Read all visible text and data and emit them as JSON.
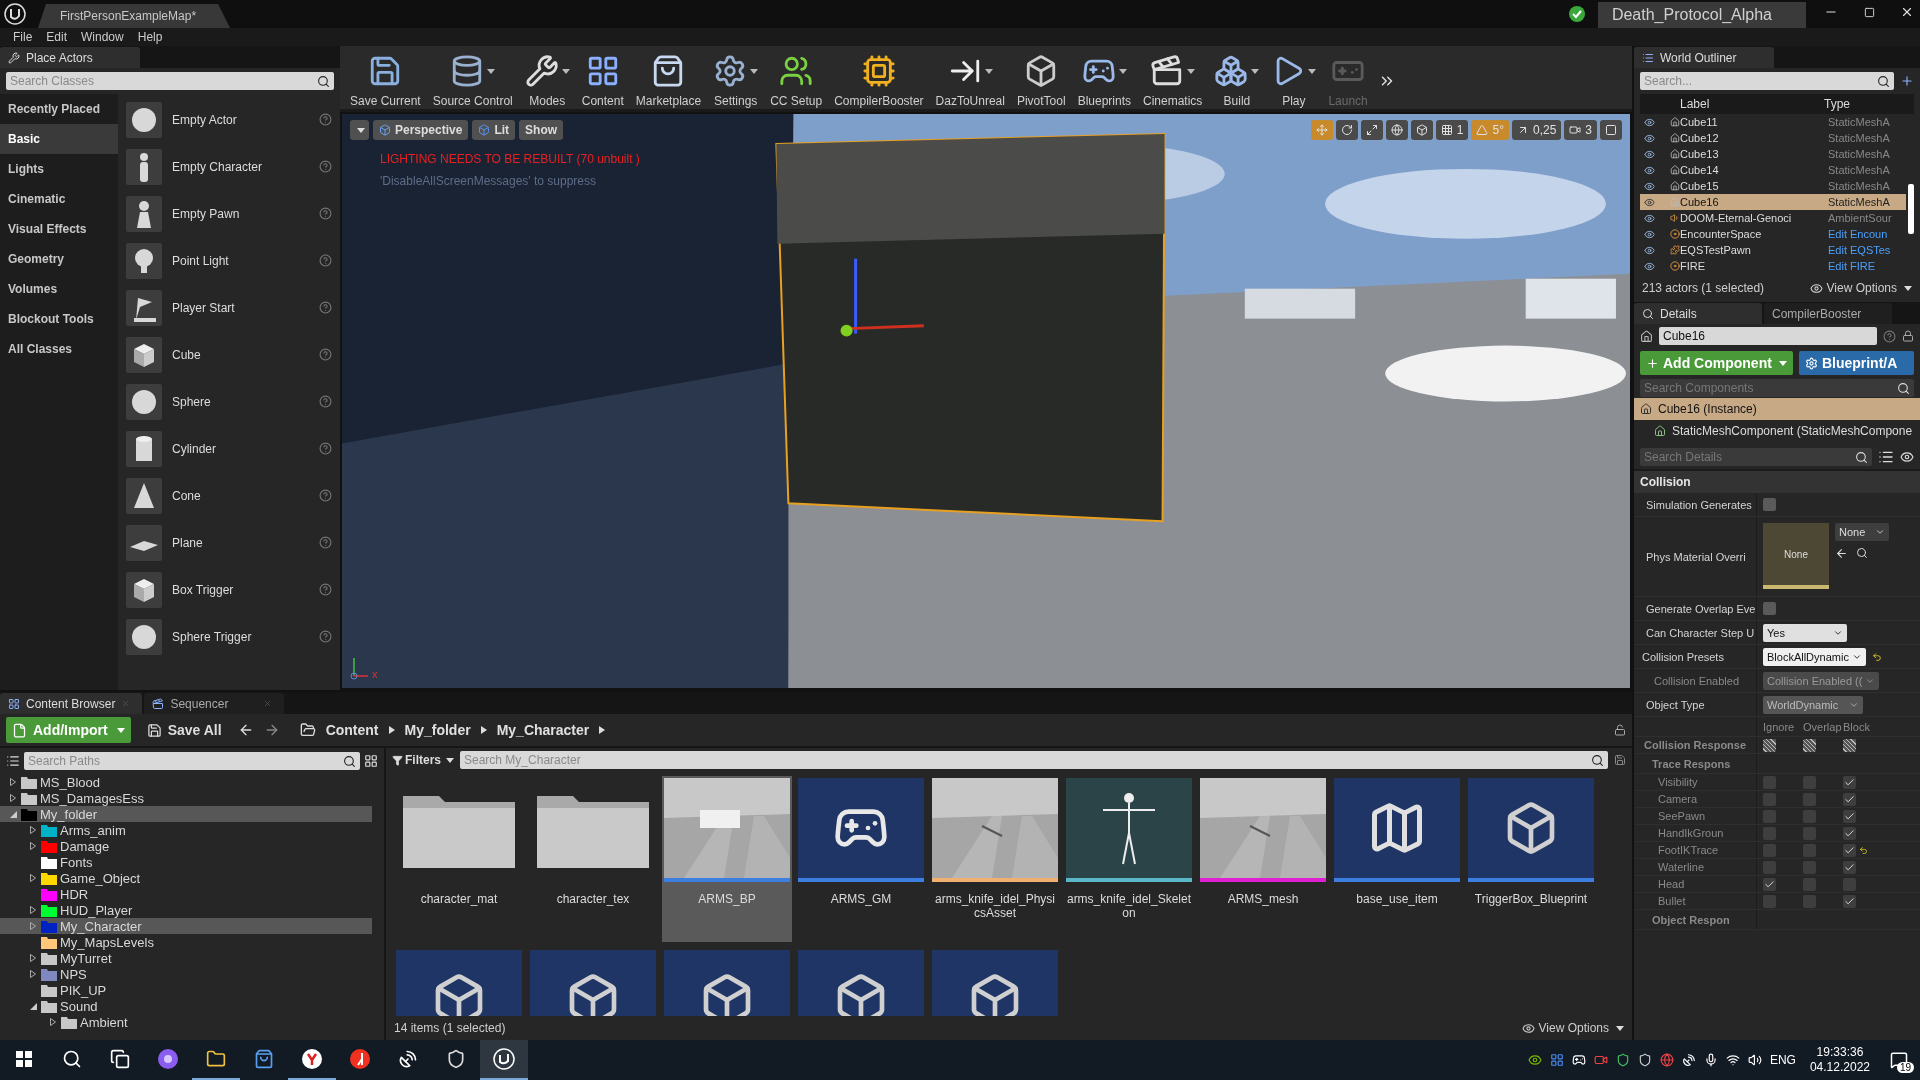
{
  "title_bar": {
    "tab": "FirstPersonExampleMap*",
    "project": "Death_Protocol_Alpha"
  },
  "menu": [
    "File",
    "Edit",
    "Window",
    "Help"
  ],
  "place_actors": {
    "tab": "Place Actors",
    "search_placeholder": "Search Classes",
    "categories": [
      {
        "label": "Recently Placed",
        "selected": false
      },
      {
        "label": "Basic",
        "selected": true
      },
      {
        "label": "Lights",
        "selected": false
      },
      {
        "label": "Cinematic",
        "selected": false
      },
      {
        "label": "Visual Effects",
        "selected": false
      },
      {
        "label": "Geometry",
        "selected": false
      },
      {
        "label": "Volumes",
        "selected": false
      },
      {
        "label": "Blockout Tools",
        "selected": false
      },
      {
        "label": "All Classes",
        "selected": false
      }
    ],
    "actors": [
      {
        "label": "Empty Actor",
        "kind": "sphere"
      },
      {
        "label": "Empty Character",
        "kind": "person"
      },
      {
        "label": "Empty Pawn",
        "kind": "pawn"
      },
      {
        "label": "Point Light",
        "kind": "light"
      },
      {
        "label": "Player Start",
        "kind": "flag"
      },
      {
        "label": "Cube",
        "kind": "cube"
      },
      {
        "label": "Sphere",
        "kind": "sphere"
      },
      {
        "label": "Cylinder",
        "kind": "cylinder"
      },
      {
        "label": "Cone",
        "kind": "cone"
      },
      {
        "label": "Plane",
        "kind": "plane"
      },
      {
        "label": "Box Trigger",
        "kind": "cube"
      },
      {
        "label": "Sphere Trigger",
        "kind": "sphere"
      }
    ]
  },
  "toolbar": [
    {
      "label": "Save Current",
      "kind": "save",
      "dropdown": false,
      "disabled": false
    },
    {
      "label": "Source Control",
      "kind": "source",
      "dropdown": true,
      "disabled": false
    },
    {
      "label": "Modes",
      "kind": "modes",
      "dropdown": true,
      "disabled": false
    },
    {
      "label": "Content",
      "kind": "content",
      "dropdown": false,
      "disabled": false
    },
    {
      "label": "Marketplace",
      "kind": "marketplace",
      "dropdown": false,
      "disabled": false
    },
    {
      "label": "Settings",
      "kind": "settings",
      "dropdown": true,
      "disabled": false
    },
    {
      "label": "CC Setup",
      "kind": "cc",
      "dropdown": false,
      "disabled": false
    },
    {
      "label": "CompilerBooster",
      "kind": "compiler",
      "dropdown": false,
      "disabled": false
    },
    {
      "label": "DazToUnreal",
      "kind": "daz",
      "dropdown": true,
      "disabled": false
    },
    {
      "label": "PivotTool",
      "kind": "pivot",
      "dropdown": false,
      "disabled": false
    },
    {
      "label": "Blueprints",
      "kind": "blueprints",
      "dropdown": true,
      "disabled": false
    },
    {
      "label": "Cinematics",
      "kind": "cinematics",
      "dropdown": true,
      "disabled": false
    },
    {
      "label": "Build",
      "kind": "build",
      "dropdown": true,
      "disabled": false
    },
    {
      "label": "Play",
      "kind": "play",
      "dropdown": true,
      "disabled": false
    },
    {
      "label": "Launch",
      "kind": "launch",
      "dropdown": false,
      "disabled": true
    }
  ],
  "viewport": {
    "menu_buttons": [
      {
        "label": "Perspective",
        "kind": "perspective"
      },
      {
        "label": "Lit",
        "kind": "lit"
      },
      {
        "label": "Show",
        "kind": "plain"
      }
    ],
    "warning": "LIGHTING NEEDS TO BE REBUILT (70 unbuilt )",
    "hint": "'DisableAllScreenMessages' to suppress",
    "axis_label": "x",
    "tools": [
      {
        "kind": "translate",
        "selected": true
      },
      {
        "kind": "rotate",
        "selected": false
      },
      {
        "kind": "scale",
        "selected": false
      },
      {
        "kind": "world",
        "selected": false
      },
      {
        "kind": "surface",
        "selected": false
      },
      {
        "kind": "grid",
        "selected": false,
        "value": "1"
      },
      {
        "kind": "angle",
        "selected": true,
        "value": "5°"
      },
      {
        "kind": "scale_snap",
        "selected": false,
        "value": "0,25"
      },
      {
        "kind": "camera_speed",
        "selected": false,
        "value": "3"
      },
      {
        "kind": "maximize",
        "selected": false
      }
    ]
  },
  "world_outliner": {
    "tab": "World Outliner",
    "search_placeholder": "Search...",
    "columns": [
      "Label",
      "Type"
    ],
    "rows": [
      {
        "label": "Cube11",
        "type": "StaticMeshA",
        "type_link": false,
        "kind": "mesh",
        "selected": false
      },
      {
        "label": "Cube12",
        "type": "StaticMeshA",
        "type_link": false,
        "kind": "mesh",
        "selected": false
      },
      {
        "label": "Cube13",
        "type": "StaticMeshA",
        "type_link": false,
        "kind": "mesh",
        "selected": false
      },
      {
        "label": "Cube14",
        "type": "StaticMeshA",
        "type_link": false,
        "kind": "mesh",
        "selected": false
      },
      {
        "label": "Cube15",
        "type": "StaticMeshA",
        "type_link": false,
        "kind": "mesh",
        "selected": false
      },
      {
        "label": "Cube16",
        "type": "StaticMeshA",
        "type_link": false,
        "kind": "mesh",
        "selected": true
      },
      {
        "label": "DOOM-Eternal-Genoci",
        "type": "AmbientSour",
        "type_link": false,
        "kind": "sound",
        "selected": false
      },
      {
        "label": "EncounterSpace",
        "type": "Edit Encoun",
        "type_link": true,
        "kind": "blueprint",
        "selected": false
      },
      {
        "label": "EQSTestPawn",
        "type": "Edit EQSTes",
        "type_link": true,
        "kind": "pawn",
        "selected": false
      },
      {
        "label": "FIRE",
        "type": "Edit FIRE",
        "type_link": true,
        "kind": "blueprint",
        "selected": false
      }
    ],
    "status": "213 actors (1 selected)",
    "view_options": "View Options"
  },
  "details": {
    "tabs": [
      {
        "label": "Details",
        "selected": true
      },
      {
        "label": "CompilerBooster",
        "selected": false
      }
    ],
    "name": "Cube16",
    "add_component": "Add Component",
    "blueprint": "Blueprint/A",
    "components_placeholder": "Search Components",
    "components": [
      {
        "label": "Cube16 (Instance)",
        "selected": true
      },
      {
        "label": "StaticMeshComponent (StaticMeshCompone",
        "selected": false
      }
    ],
    "details_placeholder": "Search Details",
    "section": "Collision",
    "properties": [
      {
        "kind": "checkbox",
        "label": "Simulation Generates",
        "checked": false,
        "modified": false
      },
      {
        "kind": "material",
        "label": "Phys Material Overri",
        "thumb": "None",
        "value": "None",
        "modified": false
      },
      {
        "kind": "checkbox",
        "label": "Generate Overlap Eve",
        "checked": false,
        "modified": false
      },
      {
        "kind": "combo",
        "label": "Can Character Step U",
        "value": "Yes",
        "modified": false
      },
      {
        "kind": "preset",
        "label": "Collision Presets",
        "value": "BlockAllDynamic",
        "modified": true
      },
      {
        "kind": "combo_disabled",
        "label": "Collision Enabled",
        "value": "Collision Enabled ((",
        "modified": false
      },
      {
        "kind": "combo_flat",
        "label": "Object Type",
        "value": "WorldDynamic",
        "modified": false
      }
    ],
    "response_columns": [
      "Ignore",
      "Overlap",
      "Block"
    ],
    "responses": [
      {
        "kind": "all",
        "label": "Collision Response",
        "mixed": true
      },
      {
        "kind": "group",
        "label": "Trace Respons"
      },
      {
        "kind": "row",
        "label": "Visibility",
        "ignore": false,
        "overlap": false,
        "block": true,
        "modified": false
      },
      {
        "kind": "row",
        "label": "Camera",
        "ignore": false,
        "overlap": false,
        "block": true,
        "modified": false
      },
      {
        "kind": "row",
        "label": "SeePawn",
        "ignore": false,
        "overlap": false,
        "block": true,
        "modified": false
      },
      {
        "kind": "row",
        "label": "HandIkGroun",
        "ignore": false,
        "overlap": false,
        "block": true,
        "modified": false
      },
      {
        "kind": "row",
        "label": "FootIKTrace",
        "ignore": false,
        "overlap": false,
        "block": true,
        "modified": true
      },
      {
        "kind": "row",
        "label": "Waterline",
        "ignore": false,
        "overlap": false,
        "block": true,
        "modified": false
      },
      {
        "kind": "row",
        "label": "Head",
        "ignore": true,
        "overlap": false,
        "block": false,
        "modified": false
      },
      {
        "kind": "row",
        "label": "Bullet",
        "ignore": false,
        "overlap": false,
        "block": true,
        "modified": false
      },
      {
        "kind": "group",
        "label": "Object Respon"
      }
    ]
  },
  "content_browser": {
    "tabs": [
      {
        "label": "Content Browser",
        "selected": true
      },
      {
        "label": "Sequencer",
        "selected": false
      }
    ],
    "add_import": "Add/Import",
    "save_all": "Save All",
    "breadcrumb": [
      "Content",
      "My_folder",
      "My_Character"
    ],
    "paths_placeholder": "Search Paths",
    "tree": [
      {
        "label": "MS_Blood",
        "expanded": false,
        "selected": false
      },
      {
        "label": "MS_DamagesEss",
        "expanded": false,
        "selected": false
      },
      {
        "label": "My_folder",
        "expanded": true,
        "selected": true,
        "color": "#000000",
        "children": [
          {
            "label": "Arms_anim",
            "expanded": false,
            "selected": false,
            "color": "#00b4c8"
          },
          {
            "label": "Damage",
            "expanded": false,
            "selected": false,
            "color": "#ff0000"
          },
          {
            "label": "Fonts",
            "selected": false,
            "color": "#ffffff"
          },
          {
            "label": "Game_Object",
            "expanded": false,
            "selected": false,
            "color": "#ffd800"
          },
          {
            "label": "HDR",
            "selected": false,
            "color": "#ff00ff"
          },
          {
            "label": "HUD_Player",
            "expanded": false,
            "selected": false,
            "color": "#00ff30"
          },
          {
            "label": "My_Character",
            "expanded": false,
            "selected": true,
            "color": "#0022c0"
          },
          {
            "label": "My_MapsLevels",
            "selected": false,
            "color": "#ffc878"
          },
          {
            "label": "MyTurret",
            "expanded": false,
            "selected": false
          },
          {
            "label": "NPS",
            "expanded": false,
            "selected": false,
            "color": "#8088c0"
          },
          {
            "label": "PIK_UP",
            "selected": false
          },
          {
            "label": "Sound",
            "expanded": true,
            "selected": false,
            "children": [
              {
                "label": "Ambient",
                "expanded": false,
                "selected": false
              }
            ]
          }
        ]
      }
    ],
    "filters": "Filters",
    "search_placeholder": "Search My_Character",
    "assets": [
      {
        "name": "character_mat",
        "kind": "folder",
        "selected": false
      },
      {
        "name": "character_tex",
        "kind": "folder",
        "selected": false
      },
      {
        "name": "ARMS_BP",
        "kind": "blueprint_preview",
        "color": "#3d7fe0",
        "selected": true
      },
      {
        "name": "ARMS_GM",
        "kind": "gamepad",
        "color": "#3d7fe0",
        "selected": false
      },
      {
        "name": "arms_knife_idel_PhysicsAsset",
        "kind": "preview",
        "color": "#f0b070",
        "selected": false
      },
      {
        "name": "arms_knife_idel_Skeleton",
        "kind": "skeleton",
        "color": "#5ab8c8",
        "selected": false
      },
      {
        "name": "ARMS_mesh",
        "kind": "preview",
        "color": "#e020d0",
        "selected": false
      },
      {
        "name": "base_use_item",
        "kind": "map",
        "color": "#3d7fe0",
        "selected": false
      },
      {
        "name": "TriggerBox_Blueprint",
        "kind": "cube",
        "color": "#3d7fe0",
        "selected": false
      },
      {
        "kind": "cube",
        "selected": false
      },
      {
        "kind": "cube",
        "selected": false
      },
      {
        "kind": "cube",
        "selected": false
      },
      {
        "kind": "cube",
        "selected": false
      },
      {
        "kind": "cube",
        "selected": false
      }
    ],
    "status": "14 items (1 selected)",
    "view_options": "View Options"
  },
  "taskbar": {
    "apps": [
      {
        "kind": "start",
        "running": false,
        "selected": false
      },
      {
        "kind": "search",
        "running": false,
        "selected": false
      },
      {
        "kind": "taskview",
        "running": false,
        "selected": false
      },
      {
        "kind": "assistant",
        "running": false,
        "selected": false
      },
      {
        "kind": "explorer",
        "running": true,
        "selected": false
      },
      {
        "kind": "store",
        "running": false,
        "selected": false
      },
      {
        "kind": "browser",
        "running": true,
        "selected": false
      },
      {
        "kind": "yandex",
        "running": false,
        "selected": false
      },
      {
        "kind": "dish",
        "running": false,
        "selected": false
      },
      {
        "kind": "epic",
        "running": false,
        "selected": false
      },
      {
        "kind": "unreal",
        "running": true,
        "selected": true
      }
    ],
    "language": "ENG",
    "time": "19:33:36",
    "date": "04.12.2022",
    "notifications": "19"
  }
}
